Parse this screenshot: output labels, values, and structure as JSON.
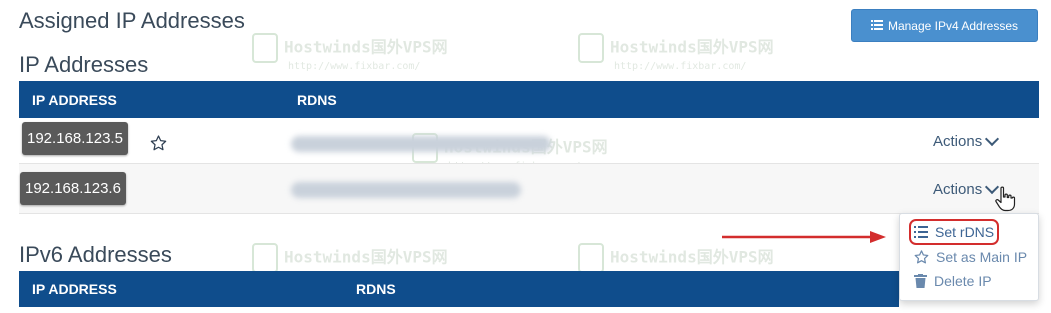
{
  "page": {
    "assigned_title": "Assigned IP Addresses",
    "manage_button": "Manage IPv4 Addresses"
  },
  "ipv4": {
    "title": "IP Addresses",
    "columns": [
      "IP ADDRESS",
      "RDNS"
    ],
    "rows": [
      {
        "ip": "192.168.123.5",
        "actions": "Actions"
      },
      {
        "ip": "192.168.123.6",
        "actions": "Actions"
      }
    ]
  },
  "ipv6": {
    "title": "IPv6 Addresses",
    "columns": [
      "IP ADDRESS",
      "RDNS"
    ]
  },
  "dropdown": {
    "items": [
      {
        "label": "Set rDNS",
        "icon": "list-icon"
      },
      {
        "label": "Set as Main IP",
        "icon": "star-icon"
      },
      {
        "label": "Delete IP",
        "icon": "trash-icon"
      }
    ]
  },
  "watermark": {
    "brand": "Hostwinds国外VPS网",
    "url": "http://www.fixbar.com/"
  },
  "colors": {
    "header_bg": "#0f4d8c",
    "button_bg": "#4a90cf",
    "highlight": "#d32d2d"
  }
}
